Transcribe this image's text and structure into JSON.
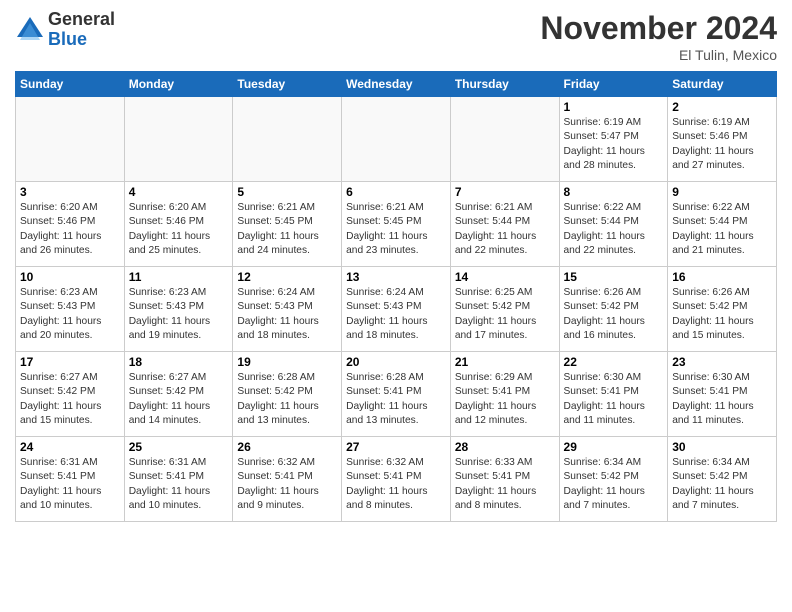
{
  "header": {
    "logo_general": "General",
    "logo_blue": "Blue",
    "month_title": "November 2024",
    "location": "El Tulin, Mexico"
  },
  "weekdays": [
    "Sunday",
    "Monday",
    "Tuesday",
    "Wednesday",
    "Thursday",
    "Friday",
    "Saturday"
  ],
  "weeks": [
    [
      {
        "day": "",
        "detail": ""
      },
      {
        "day": "",
        "detail": ""
      },
      {
        "day": "",
        "detail": ""
      },
      {
        "day": "",
        "detail": ""
      },
      {
        "day": "",
        "detail": ""
      },
      {
        "day": "1",
        "detail": "Sunrise: 6:19 AM\nSunset: 5:47 PM\nDaylight: 11 hours\nand 28 minutes."
      },
      {
        "day": "2",
        "detail": "Sunrise: 6:19 AM\nSunset: 5:46 PM\nDaylight: 11 hours\nand 27 minutes."
      }
    ],
    [
      {
        "day": "3",
        "detail": "Sunrise: 6:20 AM\nSunset: 5:46 PM\nDaylight: 11 hours\nand 26 minutes."
      },
      {
        "day": "4",
        "detail": "Sunrise: 6:20 AM\nSunset: 5:46 PM\nDaylight: 11 hours\nand 25 minutes."
      },
      {
        "day": "5",
        "detail": "Sunrise: 6:21 AM\nSunset: 5:45 PM\nDaylight: 11 hours\nand 24 minutes."
      },
      {
        "day": "6",
        "detail": "Sunrise: 6:21 AM\nSunset: 5:45 PM\nDaylight: 11 hours\nand 23 minutes."
      },
      {
        "day": "7",
        "detail": "Sunrise: 6:21 AM\nSunset: 5:44 PM\nDaylight: 11 hours\nand 22 minutes."
      },
      {
        "day": "8",
        "detail": "Sunrise: 6:22 AM\nSunset: 5:44 PM\nDaylight: 11 hours\nand 22 minutes."
      },
      {
        "day": "9",
        "detail": "Sunrise: 6:22 AM\nSunset: 5:44 PM\nDaylight: 11 hours\nand 21 minutes."
      }
    ],
    [
      {
        "day": "10",
        "detail": "Sunrise: 6:23 AM\nSunset: 5:43 PM\nDaylight: 11 hours\nand 20 minutes."
      },
      {
        "day": "11",
        "detail": "Sunrise: 6:23 AM\nSunset: 5:43 PM\nDaylight: 11 hours\nand 19 minutes."
      },
      {
        "day": "12",
        "detail": "Sunrise: 6:24 AM\nSunset: 5:43 PM\nDaylight: 11 hours\nand 18 minutes."
      },
      {
        "day": "13",
        "detail": "Sunrise: 6:24 AM\nSunset: 5:43 PM\nDaylight: 11 hours\nand 18 minutes."
      },
      {
        "day": "14",
        "detail": "Sunrise: 6:25 AM\nSunset: 5:42 PM\nDaylight: 11 hours\nand 17 minutes."
      },
      {
        "day": "15",
        "detail": "Sunrise: 6:26 AM\nSunset: 5:42 PM\nDaylight: 11 hours\nand 16 minutes."
      },
      {
        "day": "16",
        "detail": "Sunrise: 6:26 AM\nSunset: 5:42 PM\nDaylight: 11 hours\nand 15 minutes."
      }
    ],
    [
      {
        "day": "17",
        "detail": "Sunrise: 6:27 AM\nSunset: 5:42 PM\nDaylight: 11 hours\nand 15 minutes."
      },
      {
        "day": "18",
        "detail": "Sunrise: 6:27 AM\nSunset: 5:42 PM\nDaylight: 11 hours\nand 14 minutes."
      },
      {
        "day": "19",
        "detail": "Sunrise: 6:28 AM\nSunset: 5:42 PM\nDaylight: 11 hours\nand 13 minutes."
      },
      {
        "day": "20",
        "detail": "Sunrise: 6:28 AM\nSunset: 5:41 PM\nDaylight: 11 hours\nand 13 minutes."
      },
      {
        "day": "21",
        "detail": "Sunrise: 6:29 AM\nSunset: 5:41 PM\nDaylight: 11 hours\nand 12 minutes."
      },
      {
        "day": "22",
        "detail": "Sunrise: 6:30 AM\nSunset: 5:41 PM\nDaylight: 11 hours\nand 11 minutes."
      },
      {
        "day": "23",
        "detail": "Sunrise: 6:30 AM\nSunset: 5:41 PM\nDaylight: 11 hours\nand 11 minutes."
      }
    ],
    [
      {
        "day": "24",
        "detail": "Sunrise: 6:31 AM\nSunset: 5:41 PM\nDaylight: 11 hours\nand 10 minutes."
      },
      {
        "day": "25",
        "detail": "Sunrise: 6:31 AM\nSunset: 5:41 PM\nDaylight: 11 hours\nand 10 minutes."
      },
      {
        "day": "26",
        "detail": "Sunrise: 6:32 AM\nSunset: 5:41 PM\nDaylight: 11 hours\nand 9 minutes."
      },
      {
        "day": "27",
        "detail": "Sunrise: 6:32 AM\nSunset: 5:41 PM\nDaylight: 11 hours\nand 8 minutes."
      },
      {
        "day": "28",
        "detail": "Sunrise: 6:33 AM\nSunset: 5:41 PM\nDaylight: 11 hours\nand 8 minutes."
      },
      {
        "day": "29",
        "detail": "Sunrise: 6:34 AM\nSunset: 5:42 PM\nDaylight: 11 hours\nand 7 minutes."
      },
      {
        "day": "30",
        "detail": "Sunrise: 6:34 AM\nSunset: 5:42 PM\nDaylight: 11 hours\nand 7 minutes."
      }
    ]
  ]
}
